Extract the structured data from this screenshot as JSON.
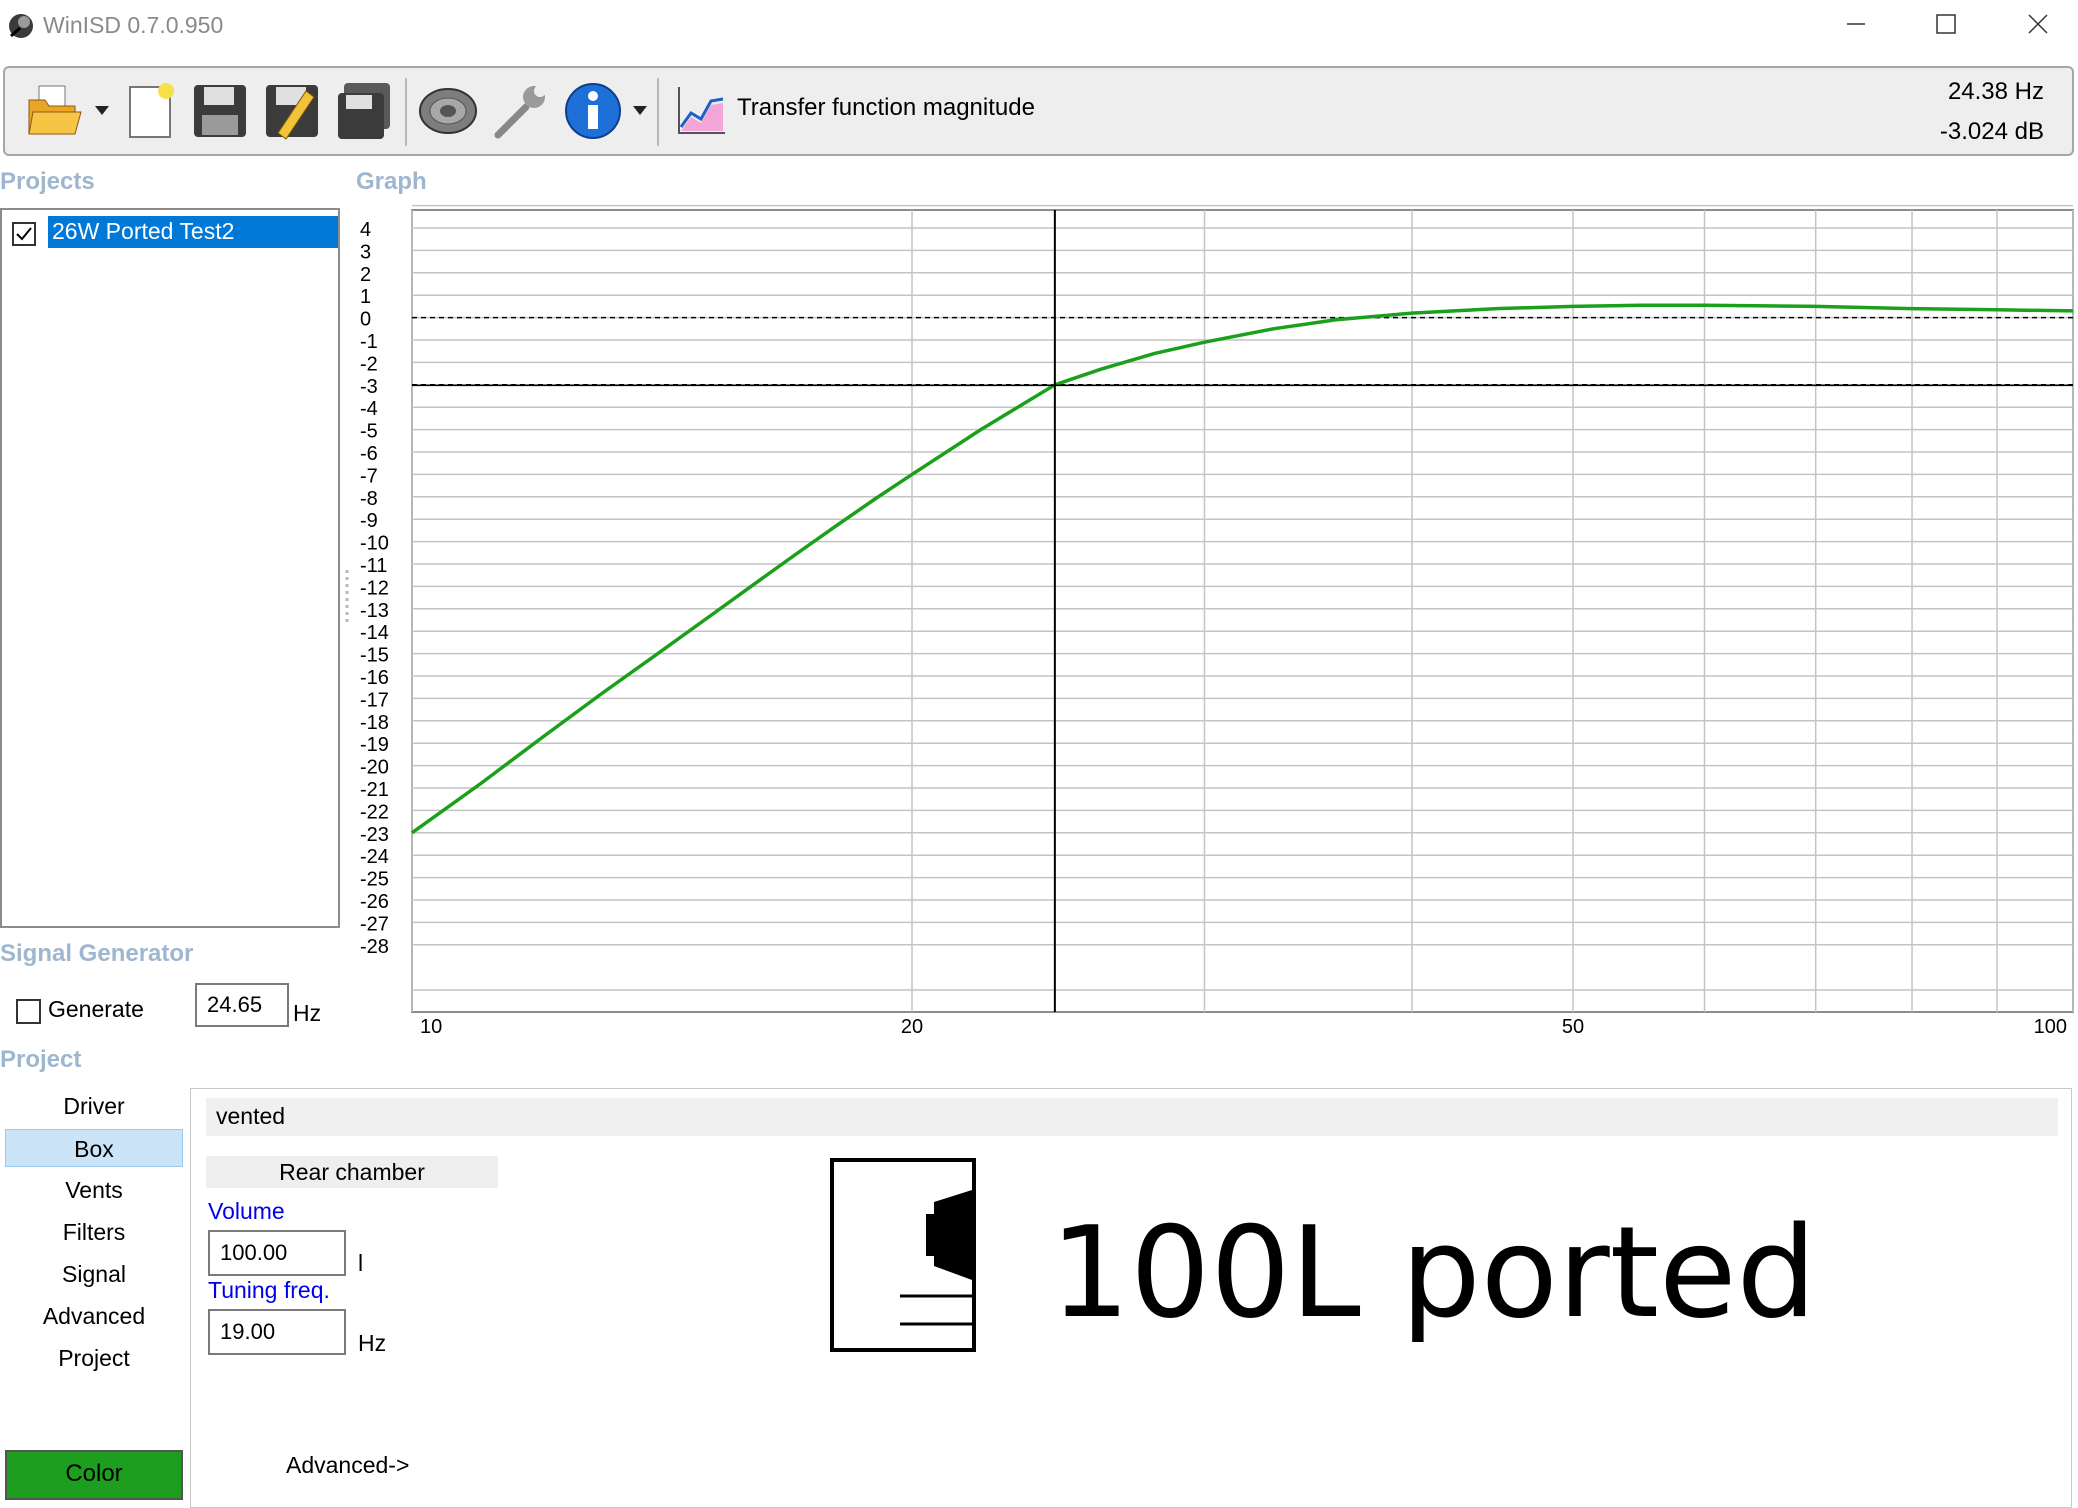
{
  "window": {
    "title": "WinISD 0.7.0.950"
  },
  "toolbar": {
    "graph_mode": "Transfer function magnitude",
    "readout_freq": "24.38 Hz",
    "readout_db": "-3.024 dB",
    "icons": [
      "open-folder-icon",
      "new-document-icon",
      "save-icon",
      "save-as-icon",
      "save-all-icon",
      "driver-icon",
      "settings-wrench-icon",
      "info-icon",
      "chart-icon"
    ]
  },
  "sections": {
    "projects": "Projects",
    "graph": "Graph",
    "signal_generator": "Signal Generator",
    "project": "Project"
  },
  "projects": [
    {
      "name": "26W Ported Test2",
      "checked": true,
      "selected": true
    }
  ],
  "signal_generator": {
    "generate_label": "Generate",
    "frequency": "24.65",
    "unit": "Hz",
    "checked": false
  },
  "project_nav": {
    "items": [
      "Driver",
      "Box",
      "Vents",
      "Filters",
      "Signal",
      "Advanced",
      "Project"
    ],
    "selected": "Box",
    "color_button": "Color",
    "color_value": "#1e9e1e"
  },
  "box": {
    "type": "vented",
    "rear_chamber_label": "Rear chamber",
    "volume_label": "Volume",
    "volume_value": "100.00",
    "volume_unit": "l",
    "tuning_label": "Tuning freq.",
    "tuning_value": "19.00",
    "tuning_unit": "Hz",
    "name": "100L ported",
    "advanced_link": "Advanced->"
  },
  "chart_data": {
    "type": "line",
    "scale_x": "log",
    "xlim": [
      10,
      100
    ],
    "ylim": [
      -29,
      6
    ],
    "x_ticks": [
      {
        "value": 10,
        "label": "10"
      },
      {
        "value": 20,
        "label": "20"
      },
      {
        "value": 50,
        "label": "50"
      },
      {
        "value": 100,
        "label": "100"
      }
    ],
    "x_gridlines": [
      10,
      20,
      30,
      40,
      50,
      60,
      70,
      80,
      90,
      100
    ],
    "y_ticks": [
      4,
      3,
      2,
      1,
      0,
      -1,
      -2,
      -3,
      -4,
      -5,
      -6,
      -7,
      -8,
      -9,
      -10,
      -11,
      -12,
      -13,
      -14,
      -15,
      -16,
      -17,
      -18,
      -19,
      -20,
      -21,
      -22,
      -23,
      -24,
      -25,
      -26,
      -27,
      -28
    ],
    "grid": true,
    "ref_lines_y": [
      0,
      -3
    ],
    "cursor": {
      "x": 24.38,
      "y": -3.024
    },
    "series": [
      {
        "color": "#1aa01a",
        "x": [
          10,
          11,
          12,
          13,
          14,
          15,
          16,
          17,
          18,
          19,
          20,
          22,
          24.38,
          26,
          28,
          30,
          33,
          36,
          40,
          45,
          50,
          55,
          60,
          70,
          80,
          90,
          100
        ],
        "y": [
          -23.0,
          -20.8,
          -18.7,
          -16.8,
          -15.1,
          -13.5,
          -12.0,
          -10.6,
          -9.3,
          -8.1,
          -7.0,
          -5.0,
          -3.0,
          -2.3,
          -1.6,
          -1.1,
          -0.5,
          -0.1,
          0.2,
          0.4,
          0.5,
          0.55,
          0.55,
          0.5,
          0.4,
          0.35,
          0.3
        ]
      }
    ]
  }
}
